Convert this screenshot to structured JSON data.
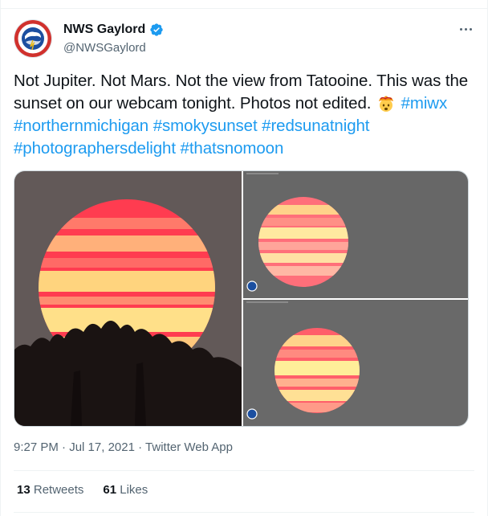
{
  "author": {
    "display_name": "NWS Gaylord",
    "handle": "@NWSGaylord",
    "avatar_icon": "nws-logo-icon",
    "verified_icon": "verified-badge-icon"
  },
  "more_icon": "more-options-icon",
  "tweet": {
    "text_1": "Not Jupiter. Not Mars. Not the view from Tatooine. This was the sunset on our webcam tonight. Photos not edited.",
    "emoji_icon": "exploding-head-emoji-icon",
    "hashtags": [
      "#miwx",
      "#northernmichigan",
      "#smokysunset",
      "#redsunatnight",
      "#photographersdelight",
      "#thatsnomoon"
    ]
  },
  "media": {
    "count": 3
  },
  "meta": {
    "time": "9:27 PM",
    "date": "Jul 17, 2021",
    "separator": "·",
    "source": "Twitter Web App"
  },
  "stats": {
    "retweets_count": "13",
    "retweets_label": "Retweets",
    "likes_count": "61",
    "likes_label": "Likes"
  },
  "colors": {
    "link": "#1d9bf0",
    "text": "#0f1419",
    "secondary": "#536471"
  }
}
